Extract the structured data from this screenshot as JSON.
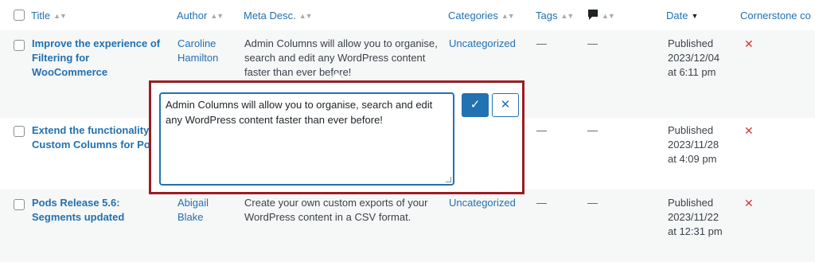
{
  "columns": {
    "title": "Title",
    "author": "Author",
    "meta_desc": "Meta Desc.",
    "categories": "Categories",
    "tags": "Tags",
    "date": "Date",
    "cornerstone": "Cornerstone co"
  },
  "sort_icons": {
    "inactive": "▲▼",
    "active": "▲▼"
  },
  "comments_icon": "comment-bubble-icon",
  "rows": [
    {
      "title_line1": "Improve the experience of",
      "title_line2": "Filtering for",
      "title_line3": "WooCommerce",
      "author_line1": "Caroline",
      "author_line2": "Hamilton",
      "meta_line1": "Admin Columns will allow you to organise,",
      "meta_line2": "search and edit any WordPress content",
      "meta_line3": "faster than ever before!",
      "category": "Uncategorized",
      "tags": "—",
      "comments": "—",
      "date_status": "Published",
      "date_day": "2023/12/04",
      "date_time": "at 6:11 pm",
      "cornerstone": "✕"
    },
    {
      "title_line1": "Extend the functionality",
      "title_line2": "Custom Columns for Po",
      "tags": "—",
      "comments": "—",
      "date_status": "Published",
      "date_day": "2023/11/28",
      "date_time": "at 4:09 pm",
      "cornerstone": "✕"
    },
    {
      "title_line1": "Pods Release 5.6:",
      "title_line2": "Segments updated",
      "author_line1": "Abigail",
      "author_line2": "Blake",
      "meta_line1": "Create your own custom exports of your",
      "meta_line2": "WordPress content in a CSV format.",
      "category": "Uncategorized",
      "tags": "—",
      "comments": "—",
      "date_status": "Published",
      "date_day": "2023/11/22",
      "date_time": "at 12:31 pm",
      "cornerstone": "✕"
    }
  ],
  "editor": {
    "value_line1": "Admin Columns will allow you to organise, search and edit",
    "value_line2": "any WordPress content faster than ever before!",
    "save_icon": "✓",
    "cancel_icon": "✕"
  },
  "colors": {
    "link": "#2271b1",
    "highlight_border": "#9b1c24",
    "cross": "#d63638"
  }
}
